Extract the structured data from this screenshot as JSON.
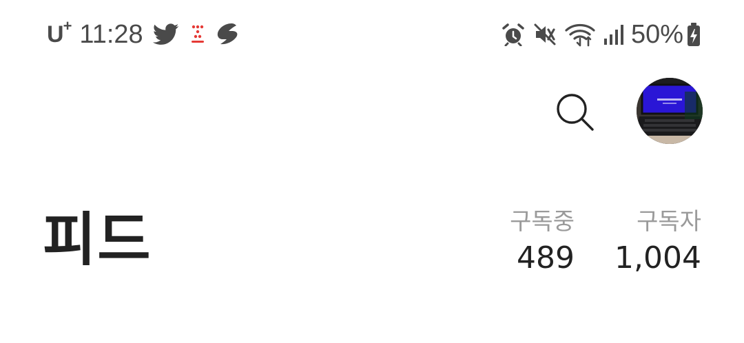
{
  "status_bar": {
    "carrier": "U",
    "carrier_plus": "+",
    "time": "11:28",
    "notification_icons": [
      "twitter-icon",
      "dots-app-icon",
      "swirl-app-icon"
    ],
    "system_icons": [
      "alarm-icon",
      "vibrate-mute-icon",
      "wifi-icon",
      "signal-icon"
    ],
    "battery_percent": "50%",
    "battery_charging": true
  },
  "header": {
    "title": "피드",
    "search_icon": "search-icon",
    "avatar_icon": "profile-avatar"
  },
  "stats": {
    "following_label": "구독중",
    "following_value": "489",
    "followers_label": "구독자",
    "followers_value": "1,004"
  },
  "colors": {
    "text_primary": "#222222",
    "text_secondary": "#9a9a9a",
    "status_icons": "#4a4a4a",
    "notification_red": "#e53935",
    "avatar_screen": "#2a16d6"
  }
}
